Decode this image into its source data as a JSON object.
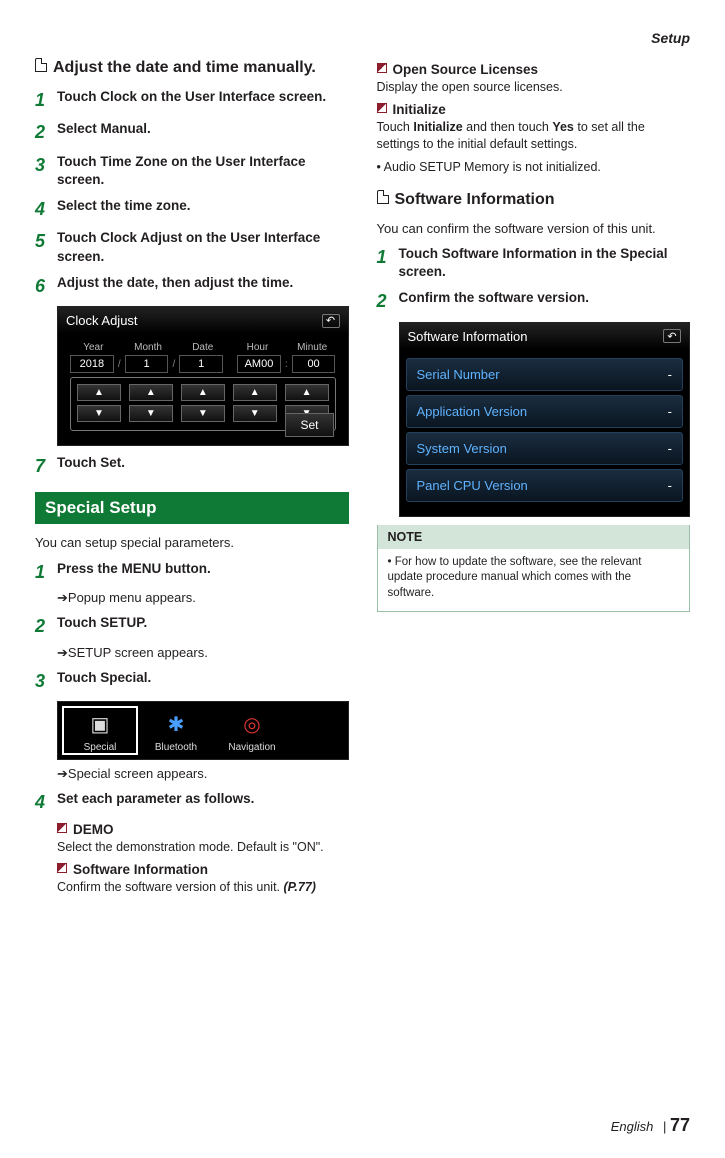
{
  "running_head": "Setup",
  "col1": {
    "head1": "Adjust the date and time manually.",
    "steps_a": [
      {
        "pre": "Touch ",
        "bold": "Clock",
        "post": " on the User Interface screen."
      },
      {
        "pre": "Select ",
        "bold": "Manual",
        "post": "."
      },
      {
        "pre": "Touch ",
        "bold": "Time Zone",
        "post": " on the User Interface screen."
      },
      {
        "pre": "Select the time zone."
      },
      {
        "pre": "Touch ",
        "bold": "Clock Adjust",
        "post": " on the User Interface screen."
      },
      {
        "pre": "Adjust the date, then adjust the time."
      }
    ],
    "clock_screen": {
      "title": "Clock Adjust",
      "cols": [
        "Year",
        "Month",
        "Date",
        "Hour",
        "Minute"
      ],
      "vals": [
        "2018",
        "1",
        "1",
        "AM00",
        "00"
      ],
      "sep": [
        "/",
        "/",
        "",
        ":"
      ],
      "set": "Set"
    },
    "step7": {
      "pre": "Touch ",
      "bold": "Set",
      "post": "."
    },
    "green": "Special Setup",
    "intro2": "You can setup special parameters.",
    "steps_b": [
      {
        "pre": "Press the ",
        "bold": "MENU",
        "post": " button.",
        "arrow": "Popup menu appears."
      },
      {
        "pre": "Touch ",
        "bold": "SETUP",
        "post": ".",
        "arrow": "SETUP screen appears."
      },
      {
        "pre": "Touch ",
        "bold": "Special",
        "post": "."
      }
    ],
    "tabs": [
      {
        "label": "Special",
        "sel": true,
        "glyph": "▣"
      },
      {
        "label": "Bluetooth",
        "sel": false,
        "glyph": "✱"
      },
      {
        "label": "Navigation",
        "sel": false,
        "glyph": "◎"
      }
    ],
    "arrow3": "Special screen appears.",
    "step_b4": "Set each parameter as follows.",
    "sq1": {
      "title": "DEMO",
      "body": "Select the demonstration mode. Default is \"ON\"."
    },
    "sq2": {
      "title": "Software Information",
      "body": "Confirm the software version of this unit.",
      "ref": "(P.77)"
    }
  },
  "col2": {
    "sq1": {
      "title": "Open Source Licenses",
      "body": "Display the open source licenses."
    },
    "sq2": {
      "title": "Initialize",
      "body_pre": "Touch ",
      "body_b1": "Initialize",
      "body_mid": " and then touch ",
      "body_b2": "Yes",
      "body_post": " to set all the settings to the initial default settings."
    },
    "dot": "Audio SETUP Memory is not initialized.",
    "head2": "Software Information",
    "intro": "You can confirm the software version of this unit.",
    "steps": [
      {
        "pre": "Touch ",
        "bold": "Software Information",
        "post": " in the Special screen."
      },
      {
        "pre": "Confirm the software version."
      }
    ],
    "si_screen": {
      "title": "Software Information",
      "rows": [
        "Serial Number",
        "Application Version",
        "System Version",
        "Panel CPU Version"
      ]
    },
    "note": {
      "head": "NOTE",
      "body": "For how to update the software, see the relevant update procedure manual which comes with the software."
    }
  },
  "footer": {
    "lang": "English",
    "page": "77",
    "sep": "|"
  }
}
